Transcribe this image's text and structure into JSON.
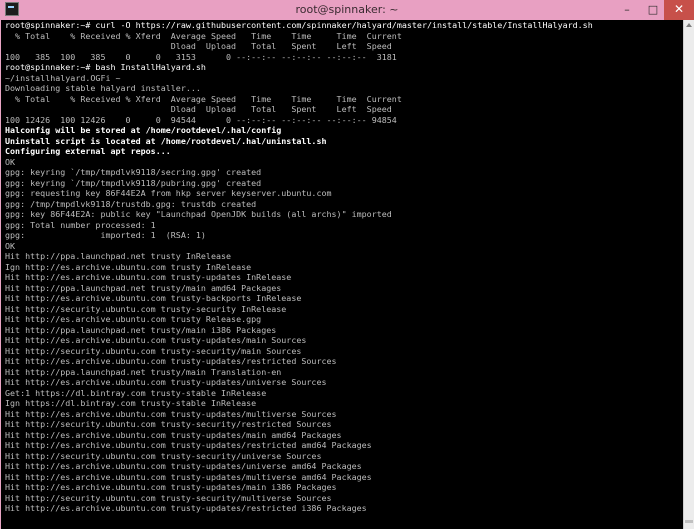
{
  "window": {
    "title": "root@spinnaker: ~",
    "minimize_label": "–",
    "maximize_label": "□",
    "close_label": "✕"
  },
  "terminal": {
    "lines": [
      "root@spinnaker:~# curl -O https://raw.githubusercontent.com/spinnaker/halyard/master/install/stable/InstallHalyard.sh",
      "  % Total    % Received % Xferd  Average Speed   Time    Time     Time  Current",
      "                                 Dload  Upload   Total   Spent    Left  Speed",
      "100   385  100   385    0     0   3153      0 --:--:-- --:--:-- --:--:--  3181",
      "root@spinnaker:~# bash InstallHalyard.sh",
      "~/installhalyard.OGFi ~",
      "Downloading stable halyard installer...",
      "  % Total    % Received % Xferd  Average Speed   Time    Time     Time  Current",
      "                                 Dload  Upload   Total   Spent    Left  Speed",
      "100 12426  100 12426    0     0  94544      0 --:--:-- --:--:-- --:--:-- 94854",
      "Halconfig will be stored at /home/rootdevel/.hal/config",
      "Uninstall script is located at /home/rootdevel/.hal/uninstall.sh",
      "Configuring external apt repos...",
      "OK",
      "gpg: keyring `/tmp/tmpdlvk9118/secring.gpg' created",
      "gpg: keyring `/tmp/tmpdlvk9118/pubring.gpg' created",
      "gpg: requesting key 86F44E2A from hkp server keyserver.ubuntu.com",
      "gpg: /tmp/tmpdlvk9118/trustdb.gpg: trustdb created",
      "gpg: key 86F44E2A: public key \"Launchpad OpenJDK builds (all archs)\" imported",
      "gpg: Total number processed: 1",
      "gpg:               imported: 1  (RSA: 1)",
      "OK",
      "Hit http://ppa.launchpad.net trusty InRelease",
      "Ign http://es.archive.ubuntu.com trusty InRelease",
      "Hit http://es.archive.ubuntu.com trusty-updates InRelease",
      "Hit http://ppa.launchpad.net trusty/main amd64 Packages",
      "Hit http://es.archive.ubuntu.com trusty-backports InRelease",
      "Hit http://security.ubuntu.com trusty-security InRelease",
      "Hit http://es.archive.ubuntu.com trusty Release.gpg",
      "Hit http://ppa.launchpad.net trusty/main i386 Packages",
      "Hit http://es.archive.ubuntu.com trusty-updates/main Sources",
      "Hit http://security.ubuntu.com trusty-security/main Sources",
      "Hit http://es.archive.ubuntu.com trusty-updates/restricted Sources",
      "Hit http://ppa.launchpad.net trusty/main Translation-en",
      "Hit http://es.archive.ubuntu.com trusty-updates/universe Sources",
      "Get:1 https://dl.bintray.com trusty-stable InRelease",
      "Ign https://dl.bintray.com trusty-stable InRelease",
      "Hit http://es.archive.ubuntu.com trusty-updates/multiverse Sources",
      "Hit http://security.ubuntu.com trusty-security/restricted Sources",
      "Hit http://es.archive.ubuntu.com trusty-updates/main amd64 Packages",
      "Hit http://es.archive.ubuntu.com trusty-updates/restricted amd64 Packages",
      "Hit http://security.ubuntu.com trusty-security/universe Sources",
      "Hit http://es.archive.ubuntu.com trusty-updates/universe amd64 Packages",
      "Hit http://es.archive.ubuntu.com trusty-updates/multiverse amd64 Packages",
      "Hit http://es.archive.ubuntu.com trusty-updates/main i386 Packages",
      "Hit http://security.ubuntu.com trusty-security/multiverse Sources",
      "Hit http://es.archive.ubuntu.com trusty-updates/restricted i386 Packages"
    ],
    "prompt_lines": [
      0,
      4
    ],
    "bold_lines": [
      10,
      11,
      12
    ]
  },
  "colors": {
    "titlebar": "#e8a0c2",
    "terminal_bg": "#000000",
    "terminal_fg": "#bdbdbd",
    "close_button": "#c7504a"
  },
  "icons": {
    "app": "terminal-icon",
    "scroll_up": "arrow-up-icon"
  }
}
